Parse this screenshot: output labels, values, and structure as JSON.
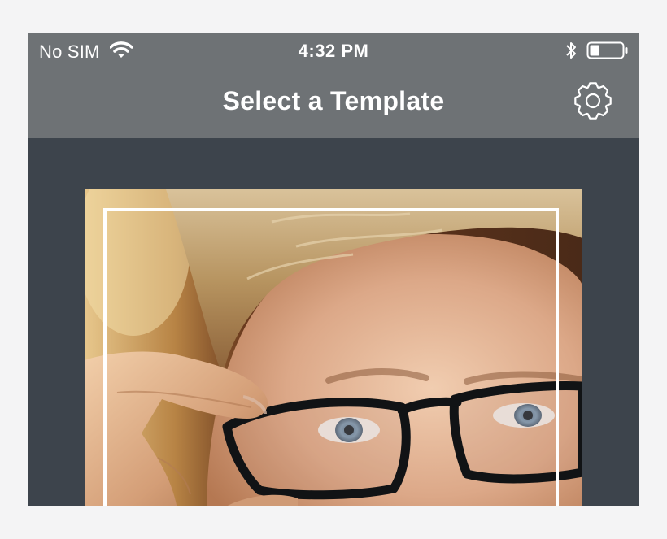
{
  "status_bar": {
    "carrier": "No SIM",
    "time": "4:32 PM",
    "wifi_icon": "wifi-icon",
    "bluetooth_icon": "bluetooth-icon",
    "battery_icon": "battery-icon",
    "battery_level": 0.3
  },
  "nav": {
    "title": "Select a Template",
    "settings_icon": "gear-icon"
  },
  "template": {
    "preview": "portrait-photo-with-white-frame"
  },
  "colors": {
    "bar": "#6e7275",
    "content_bg": "#3d444c",
    "page_bg": "#f4f4f5",
    "text": "#ffffff",
    "frame": "#ffffff"
  }
}
